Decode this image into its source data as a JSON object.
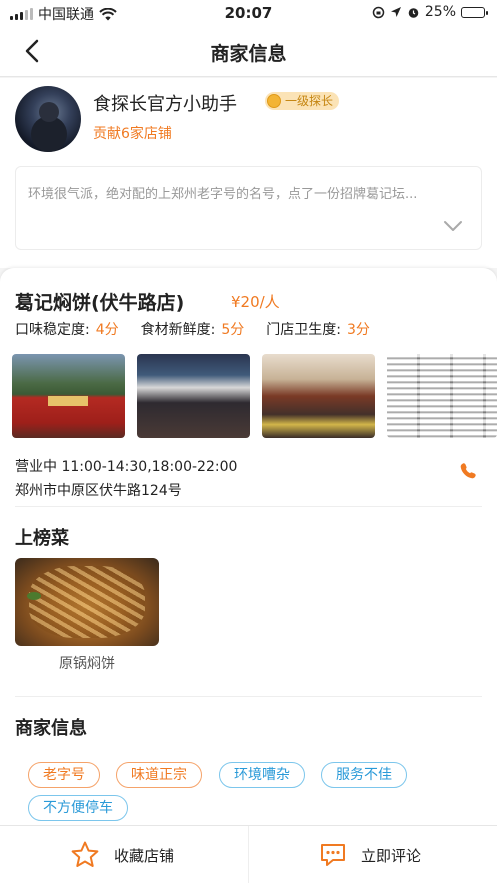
{
  "status_bar": {
    "carrier": "中国联通",
    "time": "20:07",
    "battery": "25%",
    "battery_level": 0.25
  },
  "nav": {
    "title": "商家信息"
  },
  "reviewer": {
    "name": "食探长官方小助手",
    "level": "一级探长",
    "contribution": "贡献6家店铺",
    "review_excerpt": "环境很气派，绝对配的上郑州老字号的名号，点了一份招牌葛记坛..."
  },
  "shop": {
    "name": "葛记焖饼(伏牛路店)",
    "price": "¥20/人",
    "scores": [
      {
        "label": "口味稳定度:",
        "value": "4分"
      },
      {
        "label": "食材新鲜度:",
        "value": "5分"
      },
      {
        "label": "门店卫生度:",
        "value": "3分"
      }
    ],
    "hours": "营业中 11:00-14:30,18:00-22:00",
    "address": "郑州市中原区伏牛路124号"
  },
  "ranked_dishes": {
    "title": "上榜菜",
    "items": [
      {
        "name": "原锅焖饼"
      }
    ]
  },
  "merchant_info": {
    "title": "商家信息",
    "tags": [
      {
        "text": "老字号",
        "color": "orange"
      },
      {
        "text": "味道正宗",
        "color": "orange"
      },
      {
        "text": "环境嘈杂",
        "color": "blue"
      },
      {
        "text": "服务不佳",
        "color": "blue"
      },
      {
        "text": "不方便停车",
        "color": "blue"
      }
    ]
  },
  "bottom_bar": {
    "favorite_label": "收藏店铺",
    "comment_label": "立即评论"
  },
  "colors": {
    "accent_orange": "#f07a22",
    "tag_blue": "#2a9ad8"
  }
}
